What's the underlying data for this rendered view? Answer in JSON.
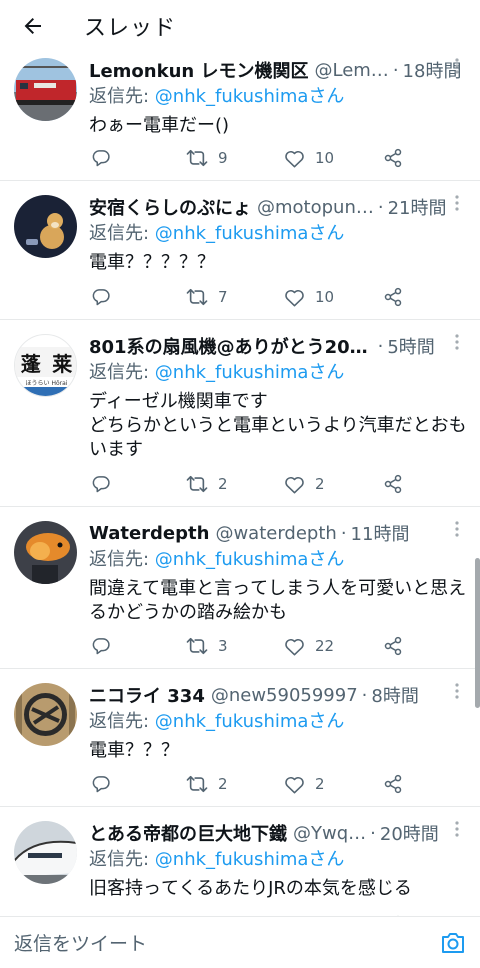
{
  "header": {
    "title": "スレッド",
    "back_icon": "arrow-left-icon"
  },
  "colors": {
    "accent": "#1d9bf0",
    "secondary_text": "#536471",
    "divider": "#e7e9ea"
  },
  "tweets": [
    {
      "name": "Lemonkun レモン機関区",
      "handle": "@Lem…",
      "time": "18時間",
      "reply_prefix": "返信先: ",
      "reply_mention": "@nhk_fukushimaさん",
      "text": "わぁー電車だー()",
      "replies": "",
      "retweets": "9",
      "likes": "10"
    },
    {
      "name": "安宿くらしのぷにょ",
      "handle": "@motopun…",
      "time": "21時間",
      "reply_prefix": "返信先: ",
      "reply_mention": "@nhk_fukushimaさん",
      "text": "電車？？？？？",
      "replies": "",
      "retweets": "7",
      "likes": "10"
    },
    {
      "name": "801系の扇風機@ありがとう20…",
      "handle": "",
      "time": "5時間",
      "reply_prefix": "返信先: ",
      "reply_mention": "@nhk_fukushimaさん",
      "text": "ディーゼル機関車です\nどちらかというと電車というより汽車だとおもいます",
      "replies": "",
      "retweets": "2",
      "likes": "2",
      "avatar_text_1": "蓬",
      "avatar_text_2": "莱",
      "avatar_sub": "ほうらい Hōrai"
    },
    {
      "name": "Waterdepth",
      "handle": "@waterdepth",
      "time": "11時間",
      "reply_prefix": "返信先: ",
      "reply_mention": "@nhk_fukushimaさん",
      "text": "間違えて電車と言ってしまう人を可愛いと思えるかどうかの踏み絵かも",
      "replies": "",
      "retweets": "3",
      "likes": "22"
    },
    {
      "name": "ニコライ 334",
      "handle": "@new59059997",
      "time": "8時間",
      "reply_prefix": "返信先: ",
      "reply_mention": "@nhk_fukushimaさん",
      "text": "電車？？？",
      "replies": "",
      "retweets": "2",
      "likes": "2"
    },
    {
      "name": "とある帝都の巨大地下鐵",
      "handle": "@Ywq…",
      "time": "20時間",
      "reply_prefix": "返信先: ",
      "reply_mention": "@nhk_fukushimaさん",
      "text": "旧客持ってくるあたりJRの本気を感じる",
      "replies": "",
      "retweets": "",
      "likes": ""
    }
  ],
  "composer": {
    "placeholder": "返信をツイート",
    "camera_icon": "camera-icon"
  }
}
